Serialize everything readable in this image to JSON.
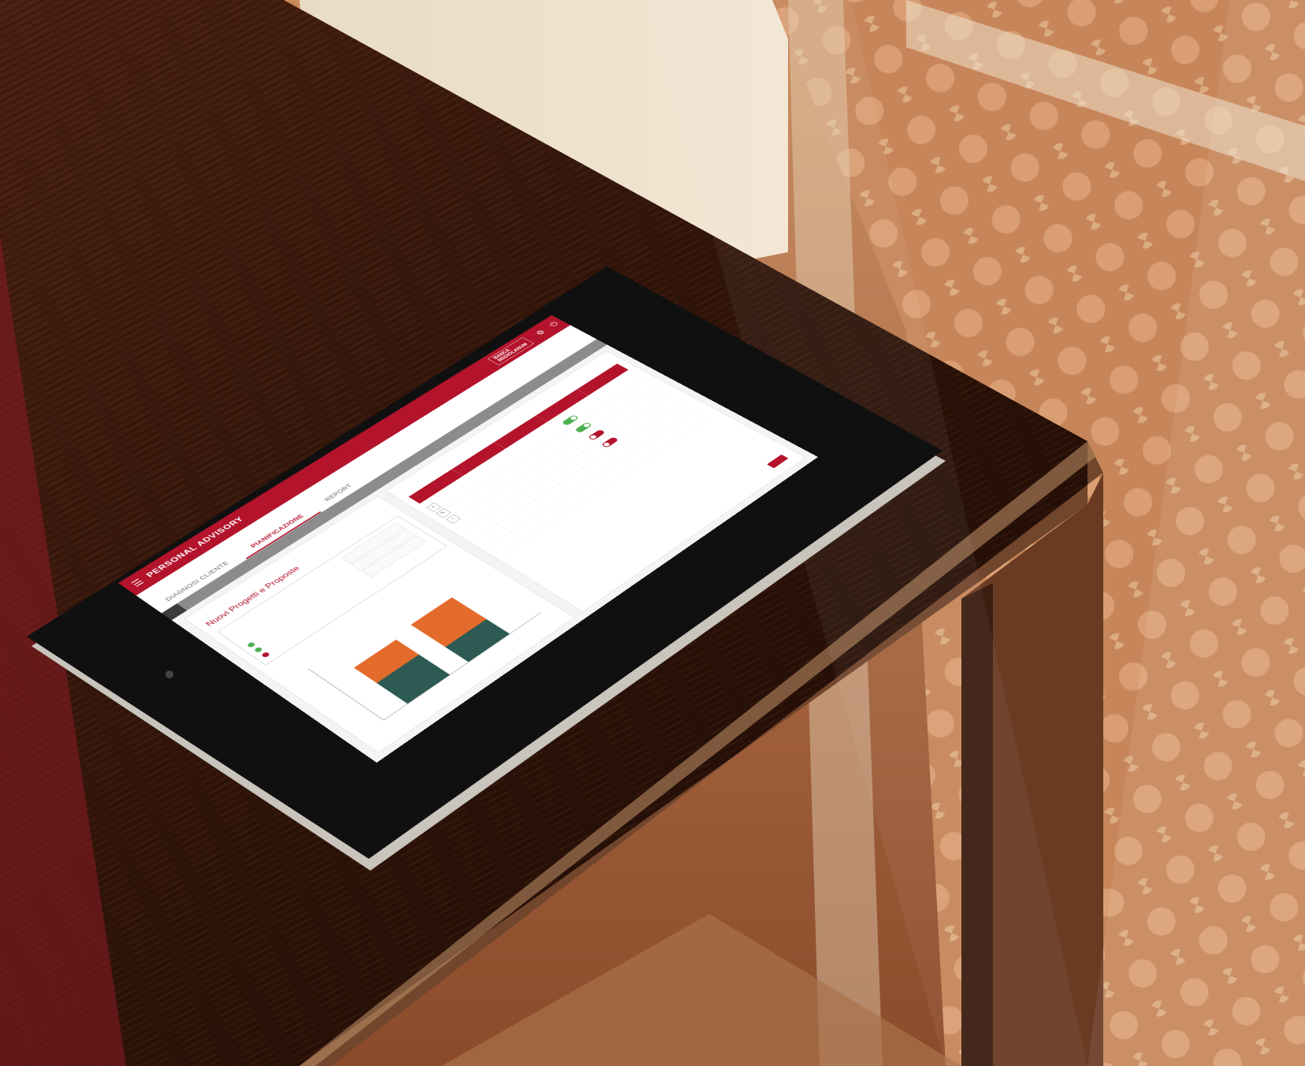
{
  "colors": {
    "brand_red": "#b3132b",
    "series_green": "#2e5a54",
    "series_orange": "#e36b2b",
    "status_ok": "#4caf50"
  },
  "topbar": {
    "menu_icon": "hamburger-icon",
    "app_title": "PERSONAL ADVISORY",
    "bank_badge_line1": "BANCA",
    "bank_badge_line2": "MEDIOLANUM",
    "settings_icon": "gear-icon",
    "exit_icon": "logout-icon"
  },
  "tabs": [
    {
      "label": "DIAGNOSI CLIENTE",
      "active": false
    },
    {
      "label": "PIANIFICAZIONE",
      "active": true
    },
    {
      "label": "REPORT",
      "active": false
    }
  ],
  "left_panel": {
    "title": "Nuovi Progetti e Proposte"
  },
  "right_panel": {
    "toggles": [
      "on",
      "on",
      "off",
      "off"
    ]
  },
  "chart_data": {
    "type": "bar",
    "categories": [
      "",
      ""
    ],
    "series": [
      {
        "values": [
          40,
          30
        ]
      },
      {
        "values": [
          30,
          45
        ]
      }
    ]
  }
}
